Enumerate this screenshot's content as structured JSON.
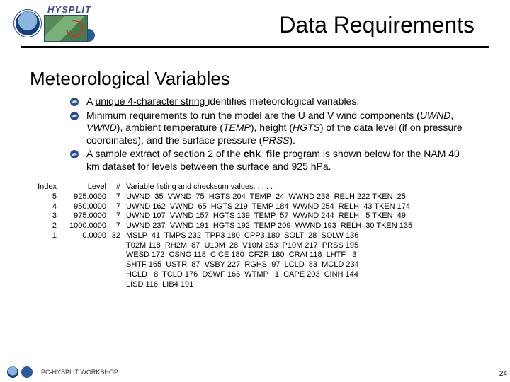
{
  "header": {
    "product": "HYSPLIT",
    "title": "Data Requirements"
  },
  "section_title": "Meteorological Variables",
  "bullets": {
    "b1_pre": "A ",
    "b1_underline": "unique 4-character string ",
    "b1_post": "identifies meteorological variables.",
    "b2_a": "Minimum requirements to run the model are the U and V wind components (",
    "b2_uwnd": "UWND",
    "b2_sep1": ", ",
    "b2_vwnd": "VWND",
    "b2_b": "), ambient temperature (",
    "b2_temp": "TEMP",
    "b2_c": "), height (",
    "b2_hgts": "HGTS",
    "b2_d": ") of the data level (if on pressure coordinates), and the surface pressure (",
    "b2_prss": "PRSS",
    "b2_e": ").",
    "b3_a": "A sample extract of section 2 of the ",
    "b3_bold": "chk_file",
    "b3_b": " program is shown below for the NAM 40 km dataset for levels between the surface and 925 hPa."
  },
  "table": {
    "h_index": "Index",
    "h_level": "Level",
    "h_num": "#",
    "h_var": "Variable listing and checksum values. . . . .",
    "idx": "5\n4\n3\n2\n1",
    "lvl": "925.0000\n950.0000\n975.0000\n1000.0000\n0.0000",
    "num": "7\n7\n7\n7\n32",
    "rows": "UWND  35  VWND  75  HGTS 204  TEMP  24  WWND 238  RELH 222 TKEN  25\nUWND 162  VWND  65  HGTS 219  TEMP 184  WWND 254  RELH  43 TKEN 174\nUWND 107  VWND 157  HGTS 139  TEMP  57  WWND 244  RELH   5 TKEN  49\nUWND 237  VWND 191  HGTS 192  TEMP 209  WWND 193  RELH  30 TKEN 135\nMSLP  41  TMPS 232  TPP3 180  CPP3 180  SOLT  28  SOLW 136\nT02M 118  RH2M  87  U10M  28  V10M 253  P10M 217  PRSS 195\nWESD 172  CSNO 118  CICE 180  CFZR 180  CRAI 118  LHTF   3\nSHTF 165  USTR  87  VSBY 227  RGHS  97  LCLD  83  MCLD 234\nHCLD   8  TCLD 176  DSWF 166  WTMP   1  CAPE 203  CINH 144\nLISD 116  LIB4 191"
  },
  "footer": {
    "text": "PC-HYSPLIT WORKSHOP",
    "page": "24"
  }
}
